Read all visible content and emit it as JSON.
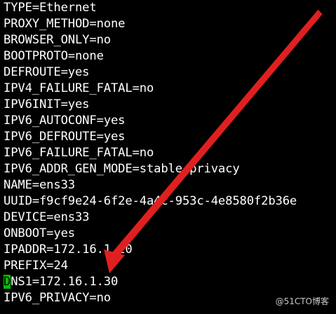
{
  "terminal": {
    "background": "#000000",
    "text_color": "#ffffff",
    "cursor_color": "#00c000",
    "lines": [
      "TYPE=Ethernet",
      "PROXY_METHOD=none",
      "BROWSER_ONLY=no",
      "BOOTPROTO=none",
      "DEFROUTE=yes",
      "IPV4_FAILURE_FATAL=no",
      "IPV6INIT=yes",
      "IPV6_AUTOCONF=yes",
      "IPV6_DEFROUTE=yes",
      "IPV6_FAILURE_FATAL=no",
      "IPV6_ADDR_GEN_MODE=stable-privacy",
      "NAME=ens33",
      "UUID=f9cf9e24-6f2e-4a4c-953c-4e8580f2b36e",
      "DEVICE=ens33",
      "ONBOOT=yes",
      "IPADDR=172.16.1.20",
      "PREFIX=24"
    ],
    "cursor_line": {
      "cursor_char": "D",
      "rest": "NS1=172.16.1.30"
    },
    "last_line": "IPV6_PRIVACY=no"
  },
  "annotation": {
    "arrow_color": "#e02020",
    "arrow_icon": "red-arrow-icon"
  },
  "watermark": "@51CTO博客"
}
